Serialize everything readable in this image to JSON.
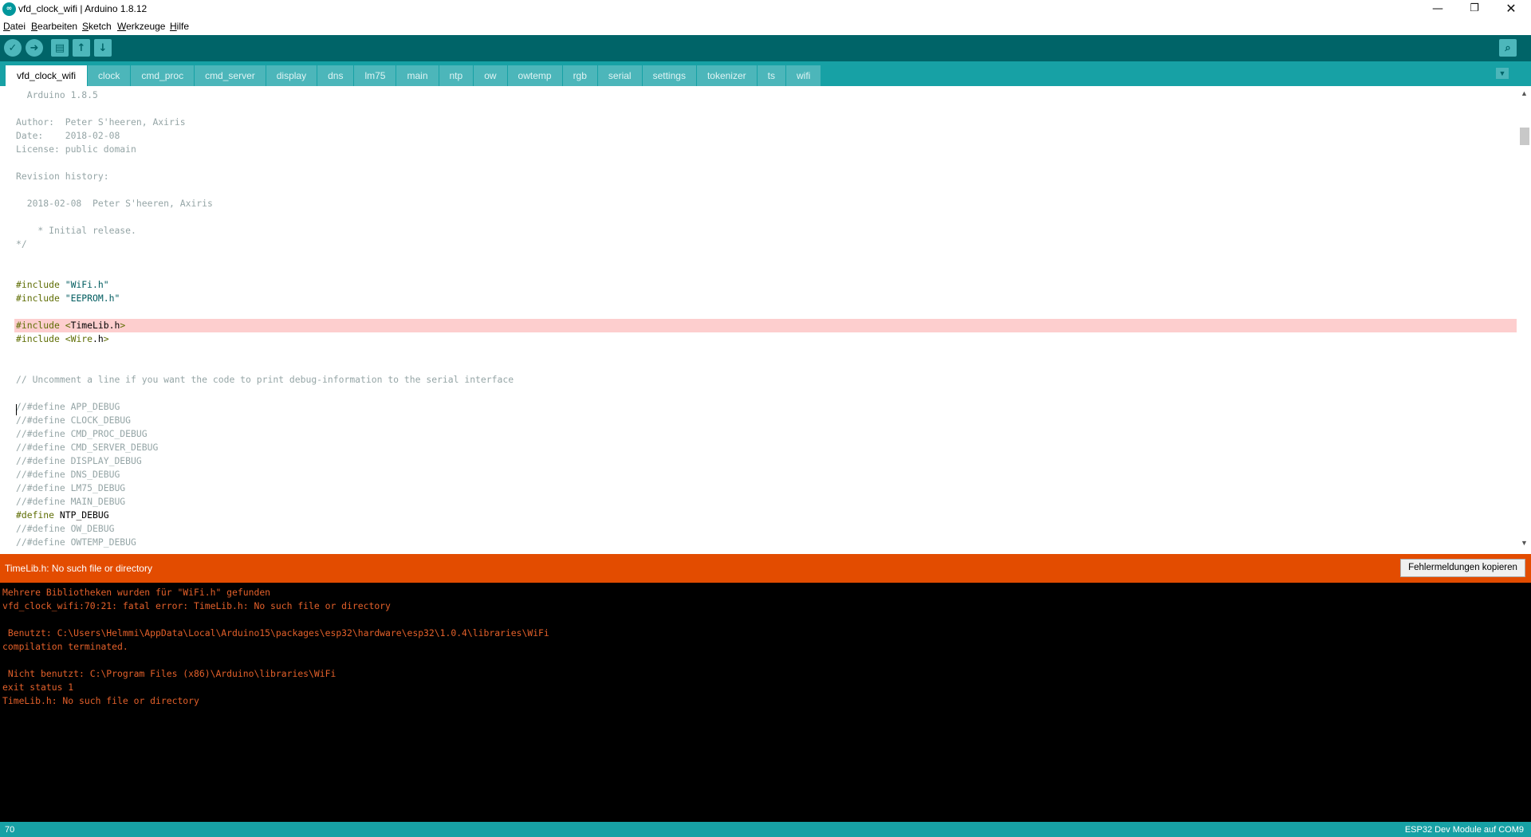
{
  "window": {
    "icon_text": "∞",
    "title": "vfd_clock_wifi | Arduino 1.8.12",
    "minimize_glyph": "—",
    "maximize_glyph": "❐",
    "close_glyph": "✕"
  },
  "menu": {
    "datei": "Datei",
    "bearbeiten": "Bearbeiten",
    "sketch": "Sketch",
    "werkzeuge": "Werkzeuge",
    "hilfe": "Hilfe"
  },
  "toolbar": {
    "verify_icon": "✓",
    "upload_icon": "➜",
    "new_icon": "▤",
    "open_icon": "↑",
    "save_icon": "↓",
    "serial_monitor_icon": "⌕"
  },
  "tabs": [
    {
      "label": "vfd_clock_wifi",
      "active": true
    },
    {
      "label": "clock"
    },
    {
      "label": "cmd_proc"
    },
    {
      "label": "cmd_server"
    },
    {
      "label": "display"
    },
    {
      "label": "dns"
    },
    {
      "label": "lm75"
    },
    {
      "label": "main"
    },
    {
      "label": "ntp"
    },
    {
      "label": "ow"
    },
    {
      "label": "owtemp"
    },
    {
      "label": "rgb"
    },
    {
      "label": "serial"
    },
    {
      "label": "settings"
    },
    {
      "label": "tokenizer"
    },
    {
      "label": "ts"
    },
    {
      "label": "wifi"
    }
  ],
  "tab_menu_icon": "▼",
  "editor": {
    "lines": [
      [
        {
          "t": "  Arduino 1.8.5",
          "c": "comment"
        }
      ],
      [],
      [
        {
          "t": "Author:  Peter S'heeren, Axiris",
          "c": "comment"
        }
      ],
      [
        {
          "t": "Date:    2018-02-08",
          "c": "comment"
        }
      ],
      [
        {
          "t": "License: public domain",
          "c": "comment"
        }
      ],
      [],
      [
        {
          "t": "Revision history:",
          "c": "comment"
        }
      ],
      [],
      [
        {
          "t": "  2018-02-08  Peter S'heeren, Axiris",
          "c": "comment"
        }
      ],
      [],
      [
        {
          "t": "    * Initial release.",
          "c": "comment"
        }
      ],
      [
        {
          "t": "*/",
          "c": "comment"
        }
      ],
      [],
      [],
      [
        {
          "t": "#include ",
          "c": "dir"
        },
        {
          "t": "\"WiFi.h\"",
          "c": "str"
        }
      ],
      [
        {
          "t": "#include ",
          "c": "dir"
        },
        {
          "t": "\"EEPROM.h\"",
          "c": "str"
        }
      ],
      [],
      [
        {
          "t": "#include ",
          "c": "dir"
        },
        {
          "t": "<",
          "c": "dir"
        },
        {
          "t": "TimeLib.h",
          "c": "macro"
        },
        {
          "t": ">",
          "c": "dir"
        }
      ],
      [
        {
          "t": "#include ",
          "c": "dir"
        },
        {
          "t": "<",
          "c": "dir"
        },
        {
          "t": "Wire",
          "c": "dir"
        },
        {
          "t": ".h",
          "c": "macro"
        },
        {
          "t": ">",
          "c": "dir"
        }
      ],
      [],
      [],
      [
        {
          "t": "// Uncomment a line if you want the code to print debug-information to the serial interface",
          "c": "comment"
        }
      ],
      [],
      [
        {
          "t": "//#define APP_DEBUG",
          "c": "comment"
        }
      ],
      [
        {
          "t": "//#define CLOCK_DEBUG",
          "c": "comment"
        }
      ],
      [
        {
          "t": "//#define CMD_PROC_DEBUG",
          "c": "comment"
        }
      ],
      [
        {
          "t": "//#define CMD_SERVER_DEBUG",
          "c": "comment"
        }
      ],
      [
        {
          "t": "//#define DISPLAY_DEBUG",
          "c": "comment"
        }
      ],
      [
        {
          "t": "//#define DNS_DEBUG",
          "c": "comment"
        }
      ],
      [
        {
          "t": "//#define LM75_DEBUG",
          "c": "comment"
        }
      ],
      [
        {
          "t": "//#define MAIN_DEBUG",
          "c": "comment"
        }
      ],
      [
        {
          "t": "#define ",
          "c": "dir"
        },
        {
          "t": "NTP_DEBUG",
          "c": "macro"
        }
      ],
      [
        {
          "t": "//#define OW_DEBUG",
          "c": "comment"
        }
      ],
      [
        {
          "t": "//#define OWTEMP_DEBUG",
          "c": "comment"
        }
      ]
    ],
    "highlighted_line_index": 17,
    "scroll_up_icon": "▲",
    "scroll_down_icon": "▼"
  },
  "error_bar": {
    "message": "TimeLib.h: No such file or directory",
    "copy_button_label": "Fehlermeldungen kopieren"
  },
  "console": {
    "lines": [
      "Mehrere Bibliotheken wurden für \"WiFi.h\" gefunden",
      "vfd_clock_wifi:70:21: fatal error: TimeLib.h: No such file or directory",
      "",
      " Benutzt: C:\\Users\\Helmmi\\AppData\\Local\\Arduino15\\packages\\esp32\\hardware\\esp32\\1.0.4\\libraries\\WiFi",
      "compilation terminated.",
      "",
      " Nicht benutzt: C:\\Program Files (x86)\\Arduino\\libraries\\WiFi",
      "exit status 1",
      "TimeLib.h: No such file or directory"
    ]
  },
  "status_bar": {
    "line_number": "70",
    "board": "ESP32 Dev Module auf COM9"
  },
  "colors": {
    "toolbar": "#006468",
    "tabbar": "#17a1a5",
    "tab_inactive": "#4cb6ba",
    "error_bar": "#e34c00",
    "console_bg": "#000000",
    "console_text": "#e3602a",
    "highlight_line": "#fdcece"
  }
}
